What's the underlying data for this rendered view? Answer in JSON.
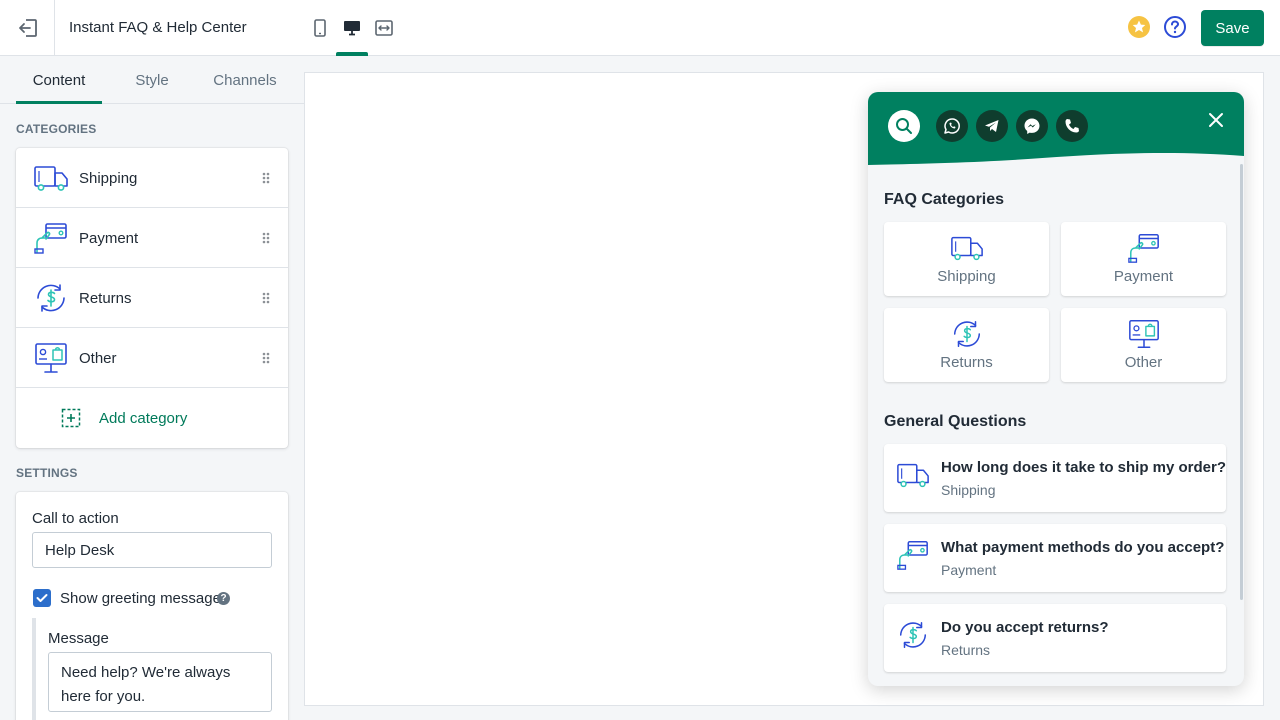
{
  "topbar": {
    "title": "Instant FAQ & Help Center",
    "save_label": "Save"
  },
  "sidebar": {
    "tabs": [
      {
        "label": "Content"
      },
      {
        "label": "Style"
      },
      {
        "label": "Channels"
      }
    ],
    "categories_heading": "CATEGORIES",
    "categories": [
      {
        "label": "Shipping",
        "icon": "shipping-truck-icon"
      },
      {
        "label": "Payment",
        "icon": "payment-card-icon"
      },
      {
        "label": "Returns",
        "icon": "returns-dollar-icon"
      },
      {
        "label": "Other",
        "icon": "other-monitor-icon"
      }
    ],
    "add_category_label": "Add category",
    "settings_heading": "SETTINGS",
    "settings": {
      "cta_label": "Call to action",
      "cta_value": "Help Desk",
      "greeting_label": "Show greeting message",
      "greeting_checked": true,
      "message_label": "Message",
      "message_value": "Need help? We're always here for you."
    }
  },
  "widget": {
    "accent_color": "#008060",
    "channel_icons": [
      "whatsapp-icon",
      "telegram-icon",
      "messenger-icon",
      "phone-icon"
    ],
    "faq_heading": "FAQ Categories",
    "faq_categories": [
      {
        "label": "Shipping"
      },
      {
        "label": "Payment"
      },
      {
        "label": "Returns"
      },
      {
        "label": "Other"
      }
    ],
    "general_heading": "General Questions",
    "questions": [
      {
        "title": "How long does it take to ship my order?",
        "category": "Shipping"
      },
      {
        "title": "What payment methods do you accept?",
        "category": "Payment"
      },
      {
        "title": "Do you accept returns?",
        "category": "Returns"
      }
    ]
  }
}
